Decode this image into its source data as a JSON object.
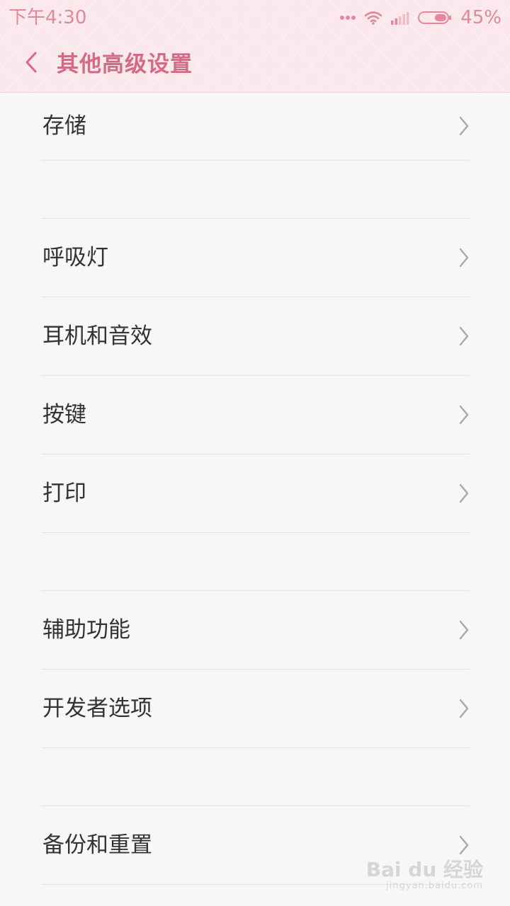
{
  "status_bar": {
    "time": "下午4:30",
    "battery_percent": "45%",
    "battery_level": 0.45
  },
  "header": {
    "title": "其他高级设置"
  },
  "settings": {
    "items": [
      {
        "label": "存储"
      },
      {
        "label": "呼吸灯"
      },
      {
        "label": "耳机和音效"
      },
      {
        "label": "按键"
      },
      {
        "label": "打印"
      },
      {
        "label": "辅助功能"
      },
      {
        "label": "开发者选项"
      },
      {
        "label": "备份和重置"
      }
    ]
  },
  "watermark": {
    "brand": "Bai du 经验",
    "url": "jingyan.baidu.com"
  },
  "colors": {
    "accent": "#d46a86",
    "status_text": "#e2889c",
    "header_bg": "#fbe8ec",
    "list_bg": "#f7f7f7",
    "divider": "#e3e3e3",
    "label_text": "#333333"
  }
}
